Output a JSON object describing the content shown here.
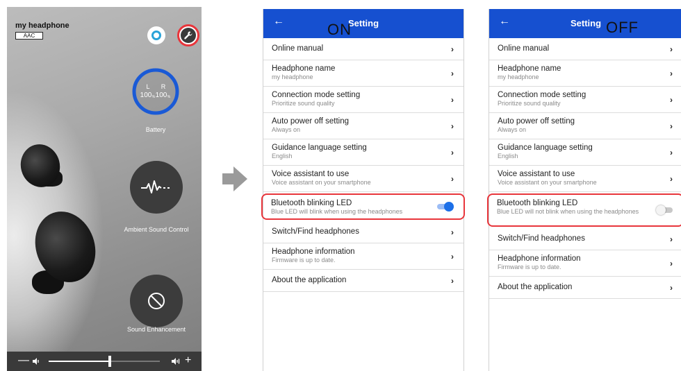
{
  "home": {
    "device_name": "my headphone",
    "codec": "AAC",
    "battery": {
      "left_label": "L",
      "right_label": "R",
      "left_value": "100",
      "right_value": "100",
      "unit": "%",
      "caption": "Battery"
    },
    "ambient_caption": "Ambient Sound Control",
    "sound_caption": "Sound Enhancement",
    "volume": {
      "minus": "—",
      "plus": "+",
      "level": 0.55
    },
    "colors": {
      "accent": "#e8353b",
      "battery_ring": "#1a5ad6",
      "alexa": "#2aa3d8"
    },
    "icons": [
      "alexa-icon",
      "wrench-icon",
      "waveform-icon",
      "sound-off-icon",
      "volume-low-icon",
      "volume-high-icon"
    ]
  },
  "settings_on": {
    "title": "Setting",
    "state_tag": "ON",
    "back": "←",
    "rows": [
      {
        "label": "Online manual",
        "sub": ""
      },
      {
        "label": "Headphone name",
        "sub": "my headphone"
      },
      {
        "label": "Connection mode setting",
        "sub": "Prioritize sound quality"
      },
      {
        "label": "Auto power off setting",
        "sub": "Always on"
      },
      {
        "label": "Guidance language setting",
        "sub": "English"
      },
      {
        "label": "Voice assistant to use",
        "sub": "Voice assistant on your smartphone"
      },
      {
        "label": "Bluetooth blinking LED",
        "sub": "Blue LED will blink when using the headphones",
        "toggle": true
      },
      {
        "label": "Switch/Find headphones",
        "sub": ""
      },
      {
        "label": "Headphone information",
        "sub": "Firmware is up to date."
      },
      {
        "label": "About the application",
        "sub": ""
      }
    ]
  },
  "settings_off": {
    "title": "Setting",
    "state_tag": "OFF",
    "back": "←",
    "rows": [
      {
        "label": "Online manual",
        "sub": ""
      },
      {
        "label": "Headphone name",
        "sub": "my headphone"
      },
      {
        "label": "Connection mode setting",
        "sub": "Prioritize sound quality"
      },
      {
        "label": "Auto power off setting",
        "sub": "Always on"
      },
      {
        "label": "Guidance language setting",
        "sub": "English"
      },
      {
        "label": "Voice assistant to use",
        "sub": "Voice assistant on your smartphone"
      },
      {
        "label": "Bluetooth blinking LED",
        "sub": "Blue LED will not blink when using the headphones",
        "toggle": false
      },
      {
        "label": "Switch/Find headphones",
        "sub": ""
      },
      {
        "label": "Headphone information",
        "sub": "Firmware is up to date."
      },
      {
        "label": "About the application",
        "sub": ""
      }
    ]
  },
  "chevron": "›"
}
